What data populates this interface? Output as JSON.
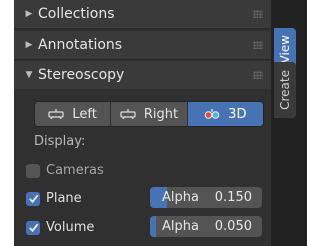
{
  "panels": [
    {
      "label": "Collections",
      "expanded": false
    },
    {
      "label": "Annotations",
      "expanded": false
    },
    {
      "label": "Stereoscopy",
      "expanded": true
    }
  ],
  "stereo_mode": {
    "options": [
      {
        "label": "Left",
        "icon": "camera-left-icon"
      },
      {
        "label": "Right",
        "icon": "camera-right-icon"
      },
      {
        "label": "3D",
        "icon": "stereo-3d-icon"
      }
    ],
    "selected": "3D"
  },
  "display": {
    "label": "Display:",
    "cameras": {
      "label": "Cameras",
      "checked": false
    },
    "plane": {
      "label": "Plane",
      "checked": true,
      "alpha_label": "Alpha",
      "alpha_value": "0.150",
      "fill_fraction": 0.15
    },
    "volume": {
      "label": "Volume",
      "checked": true,
      "alpha_label": "Alpha",
      "alpha_value": "0.050",
      "fill_fraction": 0.05
    }
  },
  "tabs": [
    {
      "label": "View",
      "active": true
    },
    {
      "label": "Create",
      "active": false
    }
  ],
  "colors": {
    "accent": "#4772b3",
    "panel_bg": "#303030",
    "header_bg": "#3a3a3a",
    "widget_bg": "#545454"
  }
}
